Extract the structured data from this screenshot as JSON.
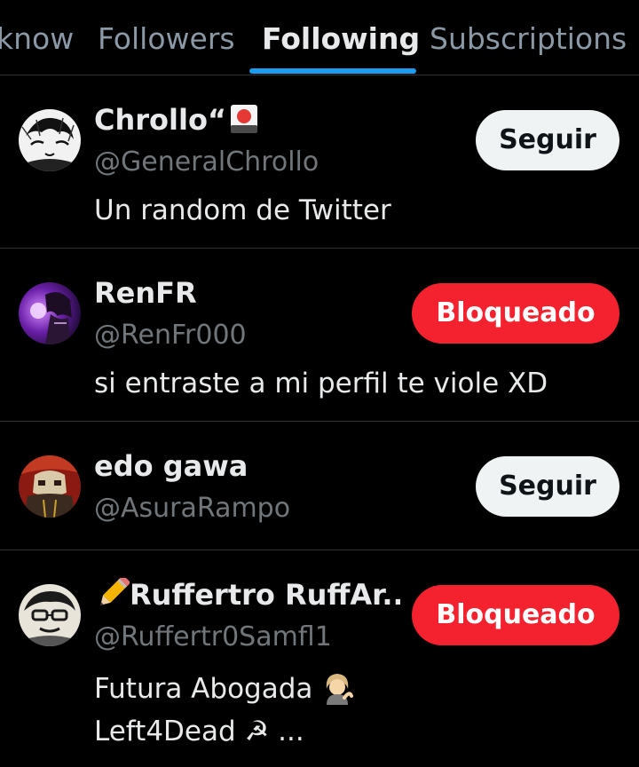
{
  "tabs": [
    {
      "label": "know",
      "active": false
    },
    {
      "label": "Followers",
      "active": false
    },
    {
      "label": "Following",
      "active": true
    },
    {
      "label": "Subscriptions",
      "active": false
    }
  ],
  "colors": {
    "accent": "#1d9bf0",
    "blocked_button": "#f4212e",
    "follow_button": "#eff3f4",
    "handle": "#71767b",
    "divider": "#2f3336"
  },
  "users": [
    {
      "name": "Chrollo“",
      "name_suffix_icon": "flag-card-icon",
      "handle": "@GeneralChrollo",
      "bio_lines": [
        "Un random de Twitter"
      ],
      "button": "Seguir",
      "button_state": "follow"
    },
    {
      "name": "RenFR",
      "handle": "@RenFr000",
      "bio_lines": [
        "si entraste a mi perfil te viole XD"
      ],
      "button": "Bloqueado",
      "button_state": "blocked"
    },
    {
      "name": "edo gawa",
      "handle": "@AsuraRampo",
      "bio_lines": [],
      "button": "Seguir",
      "button_state": "follow"
    },
    {
      "name_prefix_icon": "pencil-icon",
      "name": "Ruffertro RuffAr...",
      "handle": "@Ruffertr0Samfl1",
      "bio_lines": [
        "Futura Abogada",
        "Left4Dead ☭ ..."
      ],
      "bio_icons": [
        "woman-tipping-hand-icon"
      ],
      "button": "Bloqueado",
      "button_state": "blocked"
    }
  ]
}
